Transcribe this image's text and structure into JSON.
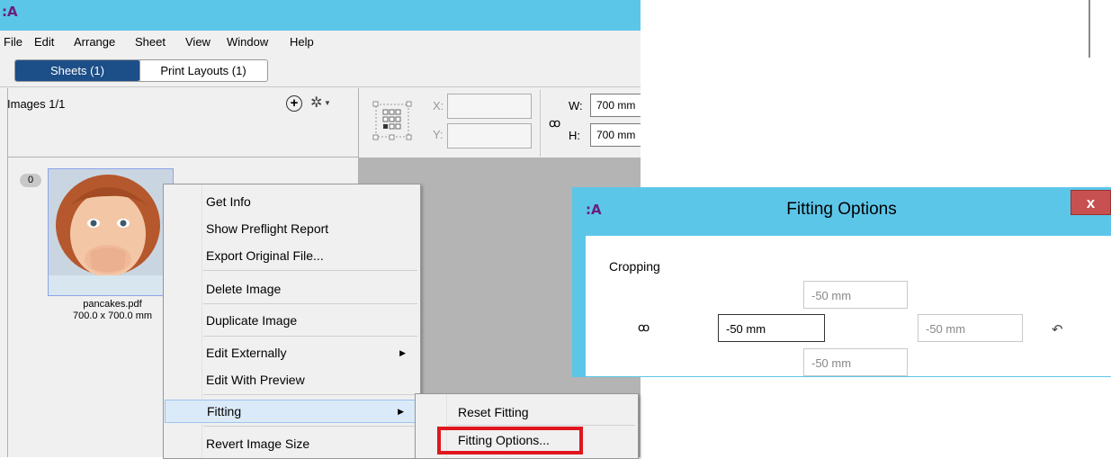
{
  "app": {
    "logo": ":A"
  },
  "menubar": [
    "File",
    "Edit",
    "Arrange",
    "Sheet",
    "View",
    "Window",
    "Help"
  ],
  "tabs": [
    {
      "label": "Sheets (1)"
    },
    {
      "label": "Print Layouts (1)"
    }
  ],
  "images_panel": {
    "title": "Images 1/1"
  },
  "transform": {
    "x_label": "X:",
    "y_label": "Y:",
    "w_label": "W:",
    "h_label": "H:",
    "w_value": "700 mm",
    "h_value": "700 mm"
  },
  "thumbnail": {
    "badge": "0",
    "filename": "pancakes.pdf",
    "size": "700.0 x 700.0 mm"
  },
  "context_menu": {
    "items": [
      "Get Info",
      "Show Preflight Report",
      "Export Original File...",
      "Delete Image",
      "Duplicate Image",
      "Edit Externally",
      "Edit With Preview",
      "Fitting",
      "Revert Image Size"
    ]
  },
  "submenu": {
    "items": [
      "Reset Fitting",
      "Fitting Options..."
    ]
  },
  "dialog": {
    "logo": ":A",
    "title": "Fitting Options",
    "close": "x",
    "cropping_label": "Cropping",
    "top": "-50 mm",
    "left": "-50 mm",
    "right": "-50 mm",
    "bottom": "-50 mm"
  },
  "colors": {
    "titlebar": "#5cc6e9",
    "tab_active": "#1c4e87",
    "highlight_box": "#e0161e",
    "close_button": "#c75050"
  }
}
